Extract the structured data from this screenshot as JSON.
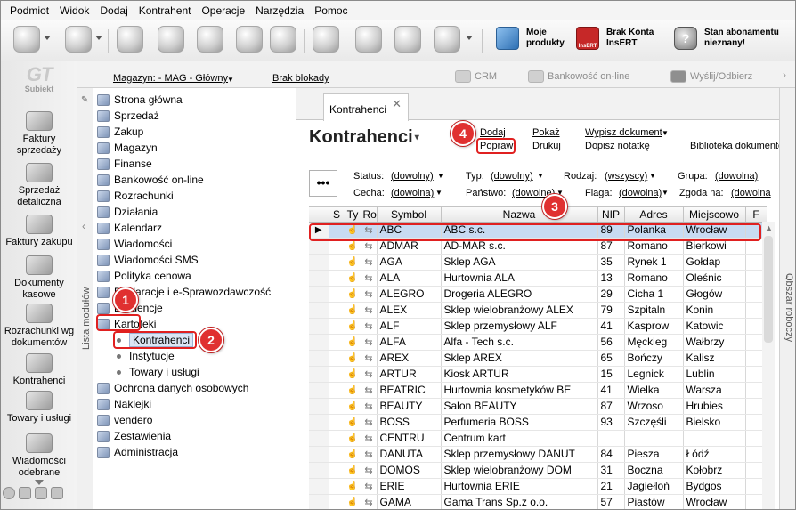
{
  "menu": [
    "Podmiot",
    "Widok",
    "Dodaj",
    "Kontrahent",
    "Operacje",
    "Narzędzia",
    "Pomoc"
  ],
  "toolbar": {
    "moje_produkty": "Moje\nprodukty",
    "brak_konta": "Brak Konta\nInsERT",
    "insert_logo": "InsERT",
    "stan_abonamentu": "Stan abonamentu\nnieznany!"
  },
  "leftnav": {
    "logo_mark": "GT",
    "logo_text": "Subiekt",
    "items": [
      {
        "label": "Faktury\nsprzedaży",
        "icon": "invoice-icon"
      },
      {
        "label": "Sprzedaż\ndetaliczna",
        "icon": "retail-icon"
      },
      {
        "label": "Faktury zakupu",
        "icon": "purchase-invoice-icon"
      },
      {
        "label": "Dokumenty\nkasowe",
        "icon": "cash-documents-icon"
      },
      {
        "label": "Rozrachunki wg\ndokumentów",
        "icon": "settlements-icon"
      },
      {
        "label": "Kontrahenci",
        "icon": "contractors-icon"
      },
      {
        "label": "Towary i usługi",
        "icon": "goods-icon"
      },
      {
        "label": "Wiadomości\nodebrane",
        "icon": "messages-icon"
      }
    ]
  },
  "locbar": {
    "magazyn": "Magazyn: - MAG - Główny",
    "brak_blokady": "Brak blokady",
    "crm": "CRM",
    "bankowosc": "Bankowość on-line",
    "wyslij": "Wyślij/Odbierz"
  },
  "modules": {
    "strip_label": "Lista modułów",
    "items": [
      "Strona główna",
      "Sprzedaż",
      "Zakup",
      "Magazyn",
      "Finanse",
      "Bankowość on-line",
      "Rozrachunki",
      "Działania",
      "Kalendarz",
      "Wiadomości",
      "Wiadomości SMS",
      "Polityka cenowa",
      "Deklaracje i e-Sprawozdawczość",
      "Ewidencje",
      "Kartoteki"
    ],
    "subitems": [
      "Kontrahenci",
      "Instytucje",
      "Towary i usługi"
    ],
    "after": [
      "Ochrona danych osobowych",
      "Naklejki",
      "vendero",
      "Zestawienia",
      "Administracja"
    ]
  },
  "callouts": [
    "1",
    "2",
    "3",
    "4"
  ],
  "main": {
    "tab_label": "Kontrahenci",
    "tab_close": "✕",
    "title": "Kontrahenci",
    "actions": {
      "dodaj": "Dodaj",
      "popraw": "Popraw",
      "pokaz": "Pokaż",
      "drukuj": "Drukuj",
      "wypisz": "Wypisz dokument",
      "dopisz": "Dopisz notatkę",
      "biblioteka": "Biblioteka dokumentó"
    },
    "more": "•••",
    "filters": {
      "status_label": "Status:",
      "status_value": "(dowolny)",
      "typ_label": "Typ:",
      "typ_value": "(dowolny)",
      "rodzaj_label": "Rodzaj:",
      "rodzaj_value": "(wszyscy)",
      "grupa_label": "Grupa:",
      "grupa_value": "(dowolna)",
      "cecha_label": "Cecha:",
      "cecha_value": "(dowolna)",
      "panstwo_label": "Państwo:",
      "panstwo_value": "(dowolne)",
      "flaga_label": "Flaga:",
      "flaga_value": "(dowolna)",
      "zgoda_label": "Zgoda na:",
      "zgoda_value": "(dowolna"
    },
    "columns": [
      "",
      "S",
      "Ty",
      "Ro",
      "Symbol",
      "Nazwa",
      "NIP",
      "Adres",
      "Miejscowo",
      "F"
    ],
    "rows": [
      {
        "symbol": "ABC",
        "nazwa": "ABC s.c.",
        "nip": "89",
        "adres": "Polanka",
        "miejscowosc": "Wrocław",
        "selected": true
      },
      {
        "symbol": "ADMAR",
        "nazwa": "AD-MAR s.c.",
        "nip": "87",
        "adres": "Romano",
        "miejscowosc": "Bierkowi"
      },
      {
        "symbol": "AGA",
        "nazwa": "Sklep AGA",
        "nip": "35",
        "adres": "Rynek 1",
        "miejscowosc": "Gołdap"
      },
      {
        "symbol": "ALA",
        "nazwa": "Hurtownia ALA",
        "nip": "13",
        "adres": "Romano",
        "miejscowosc": "Oleśnic"
      },
      {
        "symbol": "ALEGRO",
        "nazwa": "Drogeria ALEGRO",
        "nip": "29",
        "adres": "Cicha 1",
        "miejscowosc": "Głogów"
      },
      {
        "symbol": "ALEX",
        "nazwa": "Sklep wielobranżowy ALEX",
        "nip": "79",
        "adres": "Szpitaln",
        "miejscowosc": "Konin"
      },
      {
        "symbol": "ALF",
        "nazwa": "Sklep przemysłowy ALF",
        "nip": "41",
        "adres": "Kasprow",
        "miejscowosc": "Katowic"
      },
      {
        "symbol": "ALFA",
        "nazwa": "Alfa - Tech s.c.",
        "nip": "56",
        "adres": "Męckieg",
        "miejscowosc": "Wałbrzy"
      },
      {
        "symbol": "AREX",
        "nazwa": "Sklep AREX",
        "nip": "65",
        "adres": "Bończy",
        "miejscowosc": "Kalisz"
      },
      {
        "symbol": "ARTUR",
        "nazwa": "Kiosk ARTUR",
        "nip": "15",
        "adres": "Legnick",
        "miejscowosc": "Lublin"
      },
      {
        "symbol": "BEATRIC",
        "nazwa": "Hurtownia kosmetyków BE",
        "nip": "41",
        "adres": "Wielka",
        "miejscowosc": "Warsza"
      },
      {
        "symbol": "BEAUTY",
        "nazwa": "Salon BEAUTY",
        "nip": "87",
        "adres": "Wrzoso",
        "miejscowosc": "Hrubies"
      },
      {
        "symbol": "BOSS",
        "nazwa": "Perfumeria BOSS",
        "nip": "93",
        "adres": "Szczęśli",
        "miejscowosc": "Bielsko"
      },
      {
        "symbol": "CENTRU",
        "nazwa": "Centrum kart",
        "nip": "",
        "adres": "",
        "miejscowosc": ""
      },
      {
        "symbol": "DANUTA",
        "nazwa": "Sklep przemysłowy DANUT",
        "nip": "84",
        "adres": "Piesza",
        "miejscowosc": "Łódź"
      },
      {
        "symbol": "DOMOS",
        "nazwa": "Sklep wielobranżowy DOM",
        "nip": "31",
        "adres": "Boczna",
        "miejscowosc": "Kołobrz"
      },
      {
        "symbol": "ERIE",
        "nazwa": "Hurtownia ERIE",
        "nip": "21",
        "adres": "Jagiełloń",
        "miejscowosc": "Bydgos"
      },
      {
        "symbol": "GAMA",
        "nazwa": "Gama Trans Sp.z o.o.",
        "nip": "57",
        "adres": "Piastów",
        "miejscowosc": "Wrocław"
      }
    ]
  },
  "rightstrip": {
    "label": "Obszar roboczy"
  }
}
